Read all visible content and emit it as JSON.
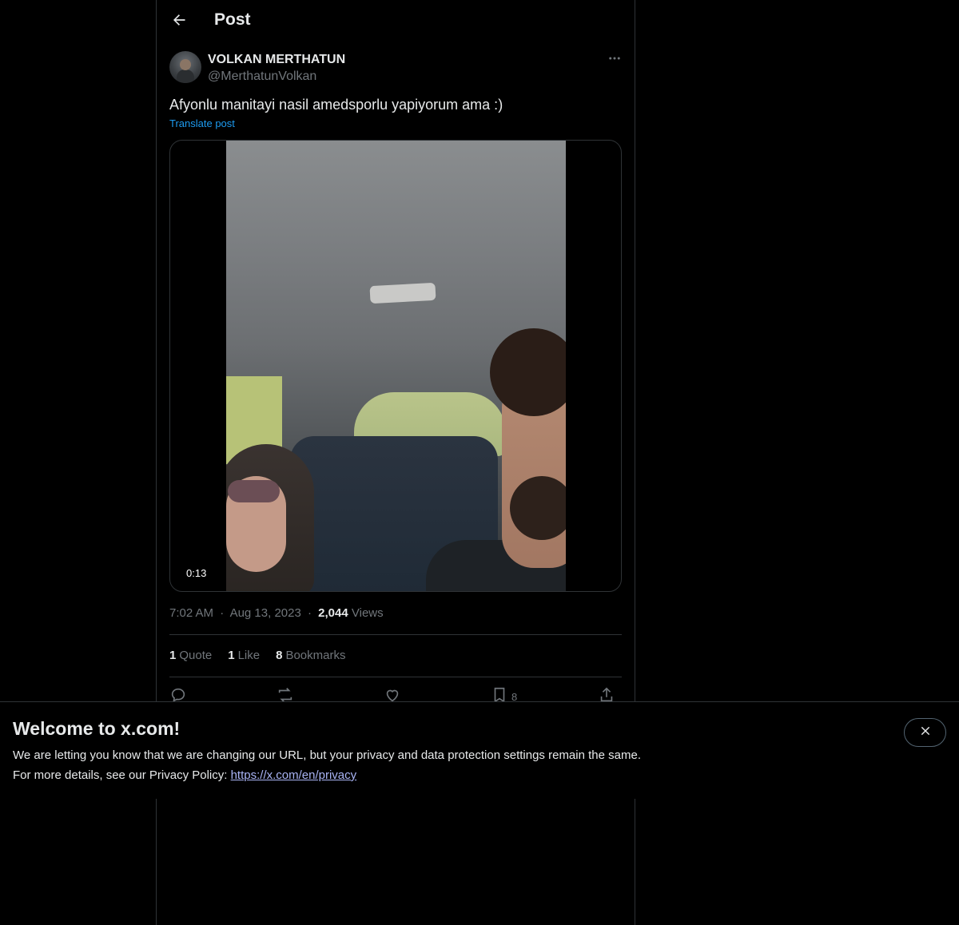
{
  "header": {
    "title": "Post",
    "back_icon": "arrow-left-icon"
  },
  "post": {
    "author_name": "VOLKAN MERTHATUN",
    "author_handle": "@MerthatunVolkan",
    "more_icon": "more-horizontal-icon",
    "text": "Afyonlu manitayi nasil amedsporlu yapiyorum ama :)",
    "translate_label": "Translate post",
    "media": {
      "duration": "0:13"
    },
    "time": "7:02 AM",
    "date": "Aug 13, 2023",
    "views_count": "2,044",
    "views_label": "Views",
    "separator": "·"
  },
  "stats": [
    {
      "num": "1",
      "label": "Quote"
    },
    {
      "num": "1",
      "label": "Like"
    },
    {
      "num": "8",
      "label": "Bookmarks"
    }
  ],
  "actions": {
    "reply_icon": "reply-icon",
    "repost_icon": "repost-icon",
    "like_icon": "heart-icon",
    "bookmark_icon": "bookmark-icon",
    "bookmark_count": "8",
    "share_icon": "share-icon"
  },
  "banner": {
    "title": "Welcome to x.com!",
    "line1": "We are letting you know that we are changing our URL, but your privacy and data protection settings remain the same.",
    "line2_prefix": "For more details, see our Privacy Policy: ",
    "link_text": "https://x.com/en/privacy",
    "close_icon": "close-icon"
  },
  "colors": {
    "background": "#000000",
    "text_primary": "#e7e9ea",
    "text_secondary": "#71767b",
    "accent": "#1d9bf0",
    "link": "#a9b4f5",
    "border": "#2f3336"
  }
}
